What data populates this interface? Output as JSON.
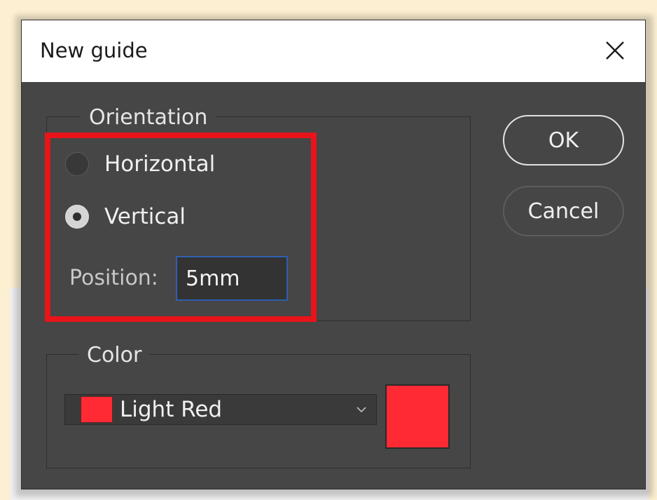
{
  "window": {
    "title": "New guide"
  },
  "orientation": {
    "legend": "Orientation",
    "options": [
      {
        "label": "Horizontal",
        "checked": false
      },
      {
        "label": "Vertical",
        "checked": true
      }
    ],
    "position_label": "Position:",
    "position_value": "5mm"
  },
  "color": {
    "legend": "Color",
    "selected": "Light Red",
    "swatch_hex": "#ff2a34"
  },
  "buttons": {
    "ok": "OK",
    "cancel": "Cancel"
  },
  "icons": {
    "close": "close-icon",
    "dropdown": "chevron-down-icon"
  },
  "colors": {
    "dialog_bg": "#464646",
    "titlebar_bg": "#ffffff",
    "highlight": "#e8141a",
    "input_focus": "#2f5fb0"
  }
}
